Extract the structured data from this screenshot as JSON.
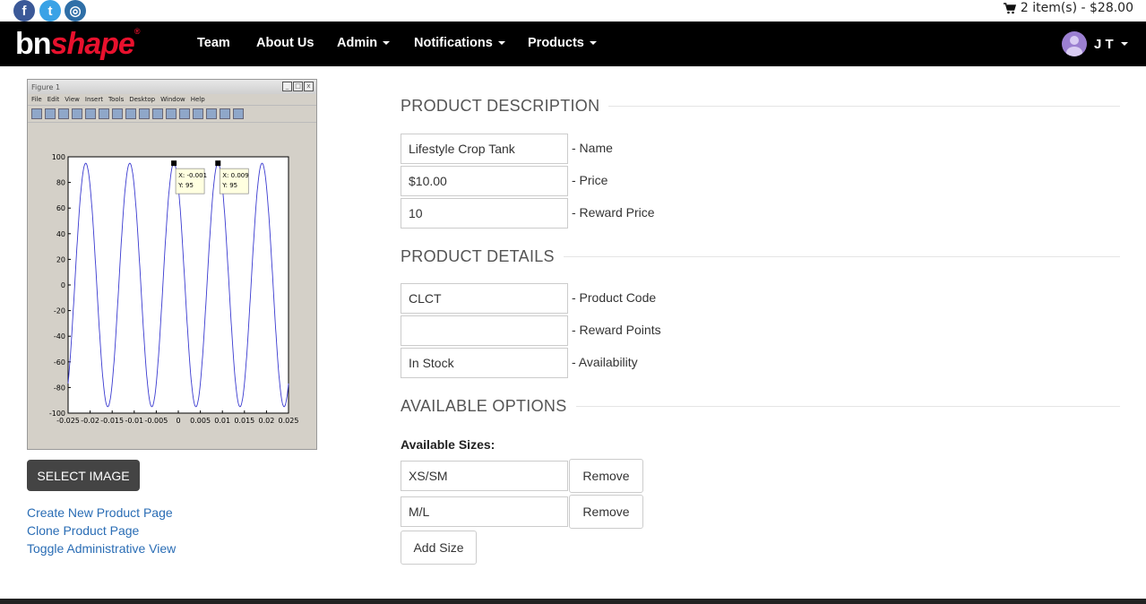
{
  "topbar": {
    "social": [
      {
        "icon": "facebook-icon",
        "glyph": "f"
      },
      {
        "icon": "twitter-icon",
        "glyph": "t"
      },
      {
        "icon": "instagram-icon",
        "glyph": "◎"
      }
    ],
    "cart_text": "2 item(s) - $28.00"
  },
  "nav": {
    "logo_white": "bn",
    "logo_red": "shape",
    "logo_reg": "®",
    "items": [
      {
        "label": "Team",
        "dropdown": false
      },
      {
        "label": "About Us",
        "dropdown": false
      },
      {
        "label": "Admin",
        "dropdown": true
      },
      {
        "label": "Notifications",
        "dropdown": true
      },
      {
        "label": "Products",
        "dropdown": true
      }
    ],
    "user_initials": "J T"
  },
  "figure": {
    "title": "Figure 1",
    "menu": [
      "File",
      "Edit",
      "View",
      "Insert",
      "Tools",
      "Desktop",
      "Window",
      "Help"
    ],
    "yticks": [
      "100",
      "80",
      "60",
      "40",
      "20",
      "0",
      "-20",
      "-40",
      "-60",
      "-80",
      "-100"
    ],
    "xticks": [
      "-0.025",
      "-0.02",
      "-0.015",
      "-0.01",
      "-0.005",
      "0",
      "0.005",
      "0.01",
      "0.015",
      "0.02",
      "0.025"
    ],
    "datatips": [
      {
        "x": "X: -0.001",
        "y": "Y: 95"
      },
      {
        "x": "X: 0.009",
        "y": "Y: 95"
      }
    ]
  },
  "left": {
    "select_image": "Select Image",
    "links": [
      "Create New Product Page",
      "Clone Product Page",
      "Toggle Administrative View"
    ]
  },
  "description": {
    "heading": "PRODUCT DESCRIPTION",
    "name_value": "Lifestyle Crop Tank",
    "name_label": "- Name",
    "price_value": "$10.00",
    "price_label": "- Price",
    "reward_price_value": "10",
    "reward_price_label": "- Reward Price"
  },
  "details": {
    "heading": "PRODUCT DETAILS",
    "code_value": "CLCT",
    "code_label": "- Product Code",
    "points_value": "",
    "points_label": "- Reward Points",
    "availability_value": "In Stock",
    "availability_label": "- Availability"
  },
  "options": {
    "heading": "AVAILABLE OPTIONS",
    "sizes_label": "Available Sizes:",
    "sizes": [
      "XS/SM",
      "M/L"
    ],
    "remove_label": "Remove",
    "add_size_label": "Add Size"
  }
}
